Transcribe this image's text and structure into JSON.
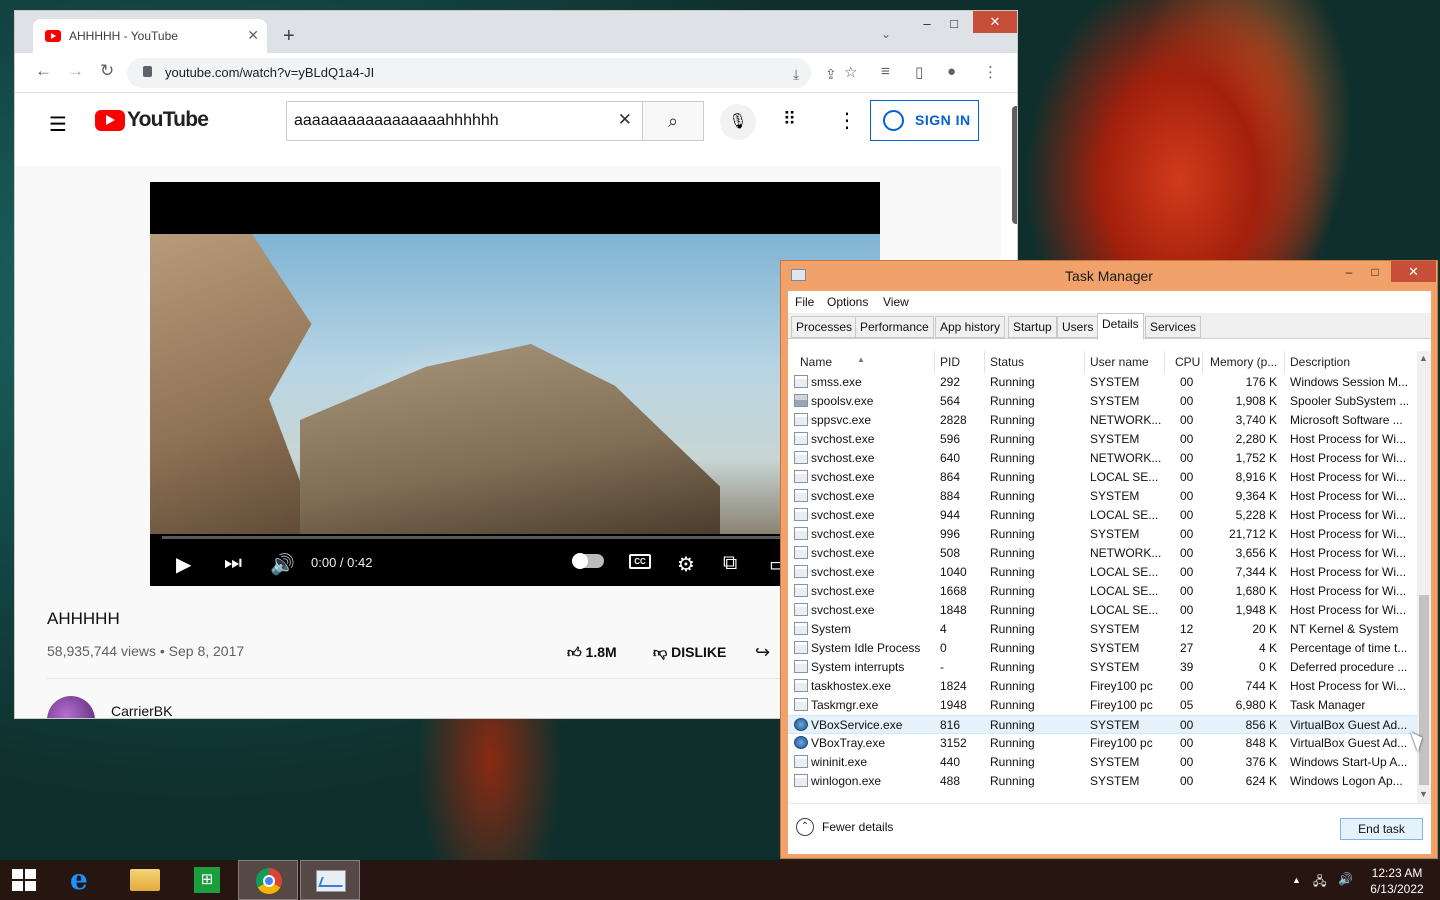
{
  "browser": {
    "tab_title": "AHHHHH - YouTube",
    "url": "youtube.com/watch?v=yBLdQ1a4-JI",
    "min_symbol": "–",
    "max_symbol": "□",
    "close_symbol": "✕"
  },
  "youtube": {
    "logo_text": "YouTube",
    "search_query": "aaaaaaaaaaaaaaaaahhhhhh",
    "sign_in_label": "SIGN IN",
    "player": {
      "time": "0:00 / 0:42",
      "cc_label": "CC",
      "progress_fraction": 0
    },
    "video_title": "AHHHHH",
    "views_date": "58,935,744 views • Sep 8, 2017",
    "likes": "1.8M",
    "dislike_label": "DISLIKE",
    "channel_name": "CarrierBK"
  },
  "task_manager": {
    "title": "Task Manager",
    "menu": [
      "File",
      "Options",
      "View"
    ],
    "tabs": [
      "Processes",
      "Performance",
      "App history",
      "Startup",
      "Users",
      "Details",
      "Services"
    ],
    "active_tab": "Details",
    "columns": [
      "Name",
      "PID",
      "Status",
      "User name",
      "CPU",
      "Memory (p...",
      "Description"
    ],
    "rows": [
      {
        "name": "smss.exe",
        "pid": "292",
        "status": "Running",
        "user": "SYSTEM",
        "cpu": "00",
        "mem": "176 K",
        "desc": "Windows Session M..."
      },
      {
        "name": "spoolsv.exe",
        "pid": "564",
        "status": "Running",
        "user": "SYSTEM",
        "cpu": "00",
        "mem": "1,908 K",
        "desc": "Spooler SubSystem ..."
      },
      {
        "name": "sppsvc.exe",
        "pid": "2828",
        "status": "Running",
        "user": "NETWORK...",
        "cpu": "00",
        "mem": "3,740 K",
        "desc": "Microsoft Software ..."
      },
      {
        "name": "svchost.exe",
        "pid": "596",
        "status": "Running",
        "user": "SYSTEM",
        "cpu": "00",
        "mem": "2,280 K",
        "desc": "Host Process for Wi..."
      },
      {
        "name": "svchost.exe",
        "pid": "640",
        "status": "Running",
        "user": "NETWORK...",
        "cpu": "00",
        "mem": "1,752 K",
        "desc": "Host Process for Wi..."
      },
      {
        "name": "svchost.exe",
        "pid": "864",
        "status": "Running",
        "user": "LOCAL SE...",
        "cpu": "00",
        "mem": "8,916 K",
        "desc": "Host Process for Wi..."
      },
      {
        "name": "svchost.exe",
        "pid": "884",
        "status": "Running",
        "user": "SYSTEM",
        "cpu": "00",
        "mem": "9,364 K",
        "desc": "Host Process for Wi..."
      },
      {
        "name": "svchost.exe",
        "pid": "944",
        "status": "Running",
        "user": "LOCAL SE...",
        "cpu": "00",
        "mem": "5,228 K",
        "desc": "Host Process for Wi..."
      },
      {
        "name": "svchost.exe",
        "pid": "996",
        "status": "Running",
        "user": "SYSTEM",
        "cpu": "00",
        "mem": "21,712 K",
        "desc": "Host Process for Wi..."
      },
      {
        "name": "svchost.exe",
        "pid": "508",
        "status": "Running",
        "user": "NETWORK...",
        "cpu": "00",
        "mem": "3,656 K",
        "desc": "Host Process for Wi..."
      },
      {
        "name": "svchost.exe",
        "pid": "1040",
        "status": "Running",
        "user": "LOCAL SE...",
        "cpu": "00",
        "mem": "7,344 K",
        "desc": "Host Process for Wi..."
      },
      {
        "name": "svchost.exe",
        "pid": "1668",
        "status": "Running",
        "user": "LOCAL SE...",
        "cpu": "00",
        "mem": "1,680 K",
        "desc": "Host Process for Wi..."
      },
      {
        "name": "svchost.exe",
        "pid": "1848",
        "status": "Running",
        "user": "LOCAL SE...",
        "cpu": "00",
        "mem": "1,948 K",
        "desc": "Host Process for Wi..."
      },
      {
        "name": "System",
        "pid": "4",
        "status": "Running",
        "user": "SYSTEM",
        "cpu": "12",
        "mem": "20 K",
        "desc": "NT Kernel & System"
      },
      {
        "name": "System Idle Process",
        "pid": "0",
        "status": "Running",
        "user": "SYSTEM",
        "cpu": "27",
        "mem": "4 K",
        "desc": "Percentage of time t..."
      },
      {
        "name": "System interrupts",
        "pid": "-",
        "status": "Running",
        "user": "SYSTEM",
        "cpu": "39",
        "mem": "0 K",
        "desc": "Deferred procedure ..."
      },
      {
        "name": "taskhostex.exe",
        "pid": "1824",
        "status": "Running",
        "user": "Firey100 pc",
        "cpu": "00",
        "mem": "744 K",
        "desc": "Host Process for Wi..."
      },
      {
        "name": "Taskmgr.exe",
        "pid": "1948",
        "status": "Running",
        "user": "Firey100 pc",
        "cpu": "05",
        "mem": "6,980 K",
        "desc": "Task Manager"
      },
      {
        "name": "VBoxService.exe",
        "pid": "816",
        "status": "Running",
        "user": "SYSTEM",
        "cpu": "00",
        "mem": "856 K",
        "desc": "VirtualBox Guest Ad..."
      },
      {
        "name": "VBoxTray.exe",
        "pid": "3152",
        "status": "Running",
        "user": "Firey100 pc",
        "cpu": "00",
        "mem": "848 K",
        "desc": "VirtualBox Guest Ad..."
      },
      {
        "name": "wininit.exe",
        "pid": "440",
        "status": "Running",
        "user": "SYSTEM",
        "cpu": "00",
        "mem": "376 K",
        "desc": "Windows Start-Up A..."
      },
      {
        "name": "winlogon.exe",
        "pid": "488",
        "status": "Running",
        "user": "SYSTEM",
        "cpu": "00",
        "mem": "624 K",
        "desc": "Windows Logon Ap..."
      }
    ],
    "selected_row_name": "VBoxService.exe",
    "fewer_details": "Fewer details",
    "end_task": "End task"
  },
  "taskbar": {
    "time": "12:23 AM",
    "date": "6/13/2022",
    "apps": [
      "start-icon",
      "internet-explorer-icon",
      "file-explorer-icon",
      "store-icon",
      "chrome-icon",
      "task-manager-icon"
    ]
  },
  "colors": {
    "youtube_red": "#ff0000",
    "youtube_blue": "#065fd4",
    "taskmanager_frame": "#f0a26a",
    "selection": "#e5f1fb"
  }
}
